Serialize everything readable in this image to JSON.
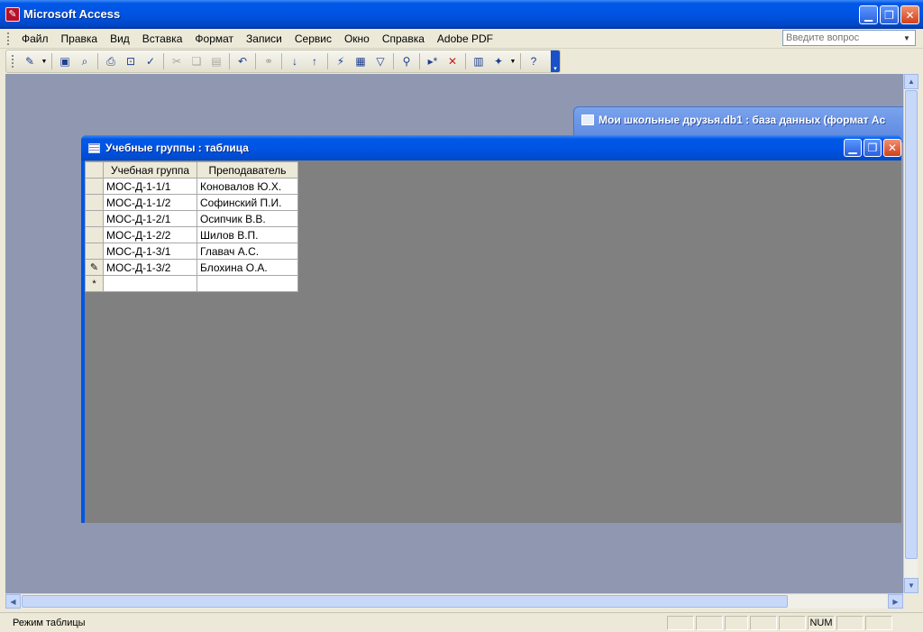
{
  "app": {
    "title": "Microsoft Access"
  },
  "menu": {
    "items": [
      "Файл",
      "Правка",
      "Вид",
      "Вставка",
      "Формат",
      "Записи",
      "Сервис",
      "Окно",
      "Справка",
      "Adobe PDF"
    ],
    "ask_placeholder": "Введите вопрос"
  },
  "toolbar": {
    "icons": [
      "view-design-icon",
      "save-icon",
      "search-file-icon",
      "print-icon",
      "print-preview-icon",
      "spelling-icon",
      "cut-icon",
      "copy-icon",
      "paste-icon",
      "undo-icon",
      "hyperlink-icon",
      "sort-ascending-icon",
      "sort-descending-icon",
      "filter-by-selection-icon",
      "filter-by-form-icon",
      "apply-filter-icon",
      "find-icon",
      "new-record-icon",
      "delete-record-icon",
      "database-window-icon",
      "new-object-icon",
      "help-icon"
    ]
  },
  "db_window": {
    "title": "Мои школьные друзья.db1 : база данных (формат Ac"
  },
  "table_window": {
    "title": "Учебные группы : таблица",
    "columns": [
      "Учебная группа",
      "Преподаватель"
    ],
    "rows": [
      {
        "group": "МОС-Д-1-1/1",
        "teacher": "Коновалов Ю.Х."
      },
      {
        "group": "МОС-Д-1-1/2",
        "teacher": "Софинский П.И."
      },
      {
        "group": "МОС-Д-1-2/1",
        "teacher": "Осипчик В.В."
      },
      {
        "group": "МОС-Д-1-2/2",
        "teacher": "Шилов В.П."
      },
      {
        "group": "МОС-Д-1-3/1",
        "teacher": "Главач А.С."
      },
      {
        "group": "МОС-Д-1-3/2",
        "teacher": "Блохина О.А."
      }
    ],
    "new_row_marker": "*",
    "edit_row_marker": "✎"
  },
  "status": {
    "mode": "Режим таблицы",
    "num": "NUM"
  },
  "colors": {
    "titlebar": "#0054e3",
    "workspace": "#8f98b0",
    "datasheet_bg": "#808080"
  }
}
